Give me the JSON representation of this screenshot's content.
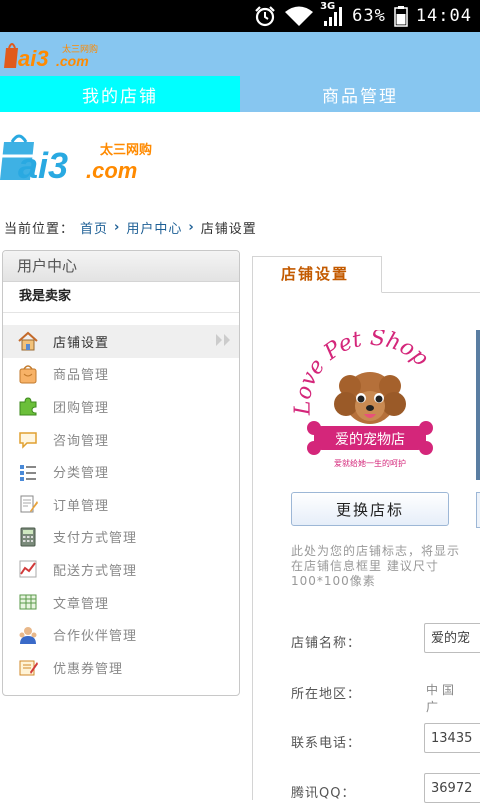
{
  "status_bar": {
    "network_type": "3G",
    "battery_percent": "63%",
    "time": "14:04",
    "icons": [
      "alarm-icon",
      "wifi-icon",
      "signal-icon",
      "battery-icon"
    ]
  },
  "header": {
    "logo_text": "Tai3.com",
    "brand_sub": "太三网购"
  },
  "tabs": [
    {
      "label": "我的店铺",
      "active": true
    },
    {
      "label": "商品管理",
      "active": false
    }
  ],
  "breadcrumb": {
    "prefix": "当前位置：",
    "items": [
      "首页",
      "用户中心",
      "店铺设置"
    ]
  },
  "sidebar": {
    "title": "用户中心",
    "role": "我是卖家",
    "items": [
      {
        "label": "店铺设置",
        "icon": "home-icon",
        "active": true
      },
      {
        "label": "商品管理",
        "icon": "bag-icon"
      },
      {
        "label": "团购管理",
        "icon": "puzzle-icon"
      },
      {
        "label": "咨询管理",
        "icon": "speech-bubble-icon"
      },
      {
        "label": "分类管理",
        "icon": "list-icon"
      },
      {
        "label": "订单管理",
        "icon": "document-edit-icon"
      },
      {
        "label": "支付方式管理",
        "icon": "calculator-icon"
      },
      {
        "label": "配送方式管理",
        "icon": "chart-icon"
      },
      {
        "label": "文章管理",
        "icon": "table-icon"
      },
      {
        "label": "合作伙伴管理",
        "icon": "users-icon"
      },
      {
        "label": "优惠券管理",
        "icon": "coupon-icon"
      }
    ]
  },
  "content": {
    "tab_label": "店铺设置",
    "shop_logo": {
      "line1": "Love Pet Shop",
      "line2": "爱的宠物店",
      "line3": "爱就给她一生的呵护"
    },
    "change_logo_button": "更换店标",
    "logo_hint": "此处为您的店铺标志，将显示在店铺信息框里 建议尺寸100*100像素",
    "form": {
      "shop_name_label": "店铺名称：",
      "shop_name_value": "爱的宠",
      "region_label": "所在地区：",
      "region_value": "中国 广",
      "phone_label": "联系电话：",
      "phone_value": "13435",
      "qq_label": "腾讯QQ：",
      "qq_value": "36972"
    }
  },
  "colors": {
    "header_bg": "#87c6f0",
    "active_tab_bg": "#00ffff",
    "content_tab_text": "#c35a00",
    "link": "#1d5f95"
  }
}
